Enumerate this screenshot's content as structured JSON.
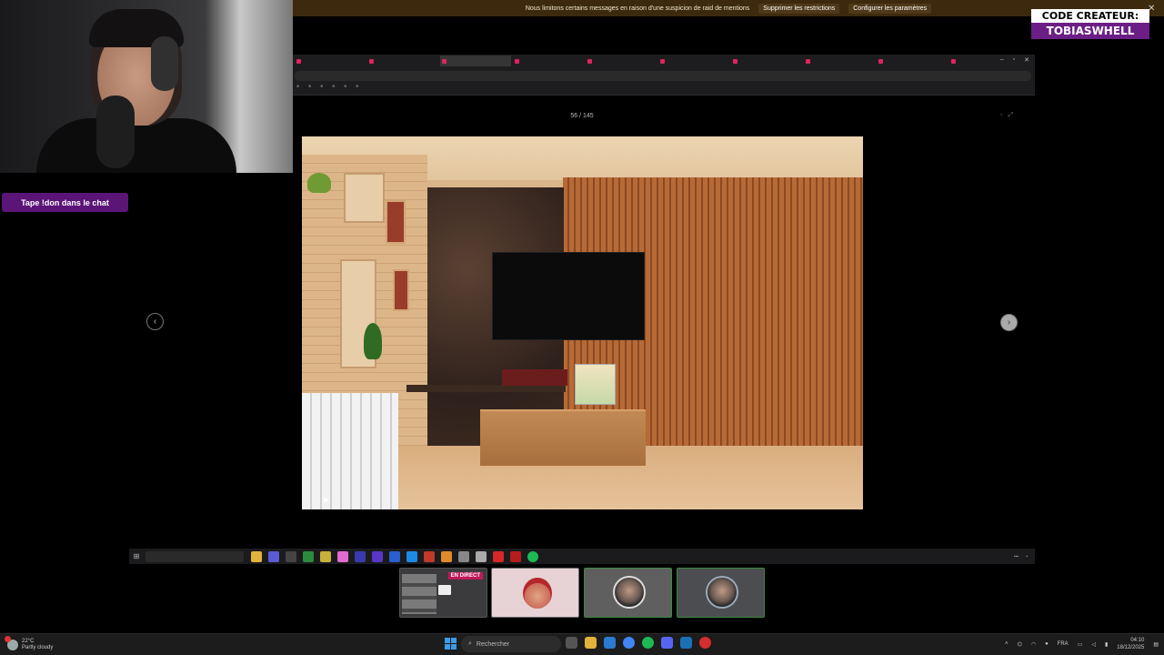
{
  "banner": {
    "message": "Nous limitons certains messages en raison d'une suspicion de raid de mentions",
    "remove_label": "Supprimer les restrictions",
    "configure_label": "Configurer les paramètres"
  },
  "creator": {
    "line1": "CODE CREATEUR:",
    "line2": "TOBIASWHELL"
  },
  "chat_badge": "Tape !don dans le chat",
  "gallery": {
    "counter": "56 / 145"
  },
  "tiles": {
    "live_label": "EN DIRECT"
  },
  "taskbar": {
    "temperature": "22°C",
    "weather": "Partly cloudy",
    "search_placeholder": "Rechercher",
    "language": "FRA",
    "time": "04:10",
    "date": "18/12/2025"
  },
  "colors": {
    "banner_bg": "#3d2a0e",
    "chat_badge_bg": "#5b1576",
    "creator_bg": "#6b1e85",
    "live_badge": "#c2185b",
    "windows_accent": "#3a9be8"
  },
  "icons": [
    "prev-arrow-icon",
    "next-arrow-icon",
    "windows-start-icon",
    "search-icon",
    "weather-icon",
    "close-icon"
  ]
}
